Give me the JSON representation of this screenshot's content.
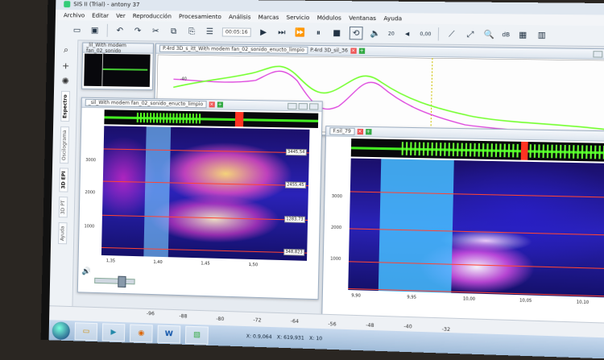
{
  "app": {
    "title": "SIS II (Trial) - antony 37"
  },
  "menu": [
    "Archivo",
    "Editar",
    "Ver",
    "Reproducción",
    "Procesamiento",
    "Análisis",
    "Marcas",
    "Servicio",
    "Módulos",
    "Ventanas",
    "Ayuda"
  ],
  "toolbar": {
    "time": "00:05:16",
    "rate": "20",
    "gain": "0,00",
    "db": "dB"
  },
  "left_tabs": [
    "Espectro",
    "Oscilograma",
    "3D EPI",
    "3D PT",
    "Ayuda"
  ],
  "windows": {
    "mini": {
      "tab": "_lil_With modem fan_02_sonido"
    },
    "top": {
      "tab_active": "P.4rd 3D_s_itt_With modem fan_02_sonido_enucto_limpio",
      "tab_other": "P.4rd 3D_sil_36",
      "ylabel": "-40"
    },
    "spec_left": {
      "tab": "_sil_With modem fan_02_sonido_enucto_limpio",
      "y_ticks": [
        "3000",
        "2000",
        "1000"
      ],
      "markers": [
        "3445,54",
        "2455,45",
        "1283,73",
        "348,823"
      ],
      "x_ticks": [
        "1,35",
        "1,40",
        "1,45",
        "1,50"
      ]
    },
    "spec_right": {
      "tab": "F.sil_79",
      "y_ticks": [
        "3000",
        "2000",
        "1000"
      ],
      "x_ticks": [
        "9,90",
        "9,95",
        "10,00",
        "10,05",
        "10,10"
      ]
    }
  },
  "bottom": {
    "scale": [
      "-96",
      "-88",
      "-80",
      "-72",
      "-64",
      "-56",
      "-48",
      "-40",
      "-32"
    ],
    "coords": [
      "X: 0.9,064",
      "X: 619,931",
      "X: 10"
    ]
  },
  "colors": {
    "accent": "#2f6fb8",
    "marker": "#ff3322",
    "green_trace": "#55ee22",
    "selection": "#3ab0ff"
  }
}
